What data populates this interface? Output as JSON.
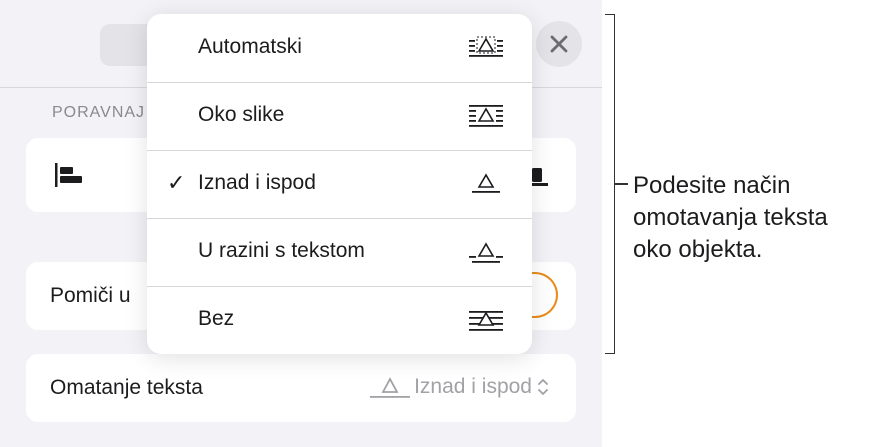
{
  "panel": {
    "section_label": "PORAVNAJ",
    "move_label": "Pomiči u",
    "wrap_label": "Omatanje teksta",
    "wrap_value": "Iznad i ispod"
  },
  "menu": {
    "items": [
      {
        "label": "Automatski",
        "checked": false,
        "icon": "wrap-automatic-icon"
      },
      {
        "label": "Oko slike",
        "checked": false,
        "icon": "wrap-around-icon"
      },
      {
        "label": "Iznad i ispod",
        "checked": true,
        "icon": "wrap-above-below-icon"
      },
      {
        "label": "U razini s tekstom",
        "checked": false,
        "icon": "wrap-inline-icon"
      },
      {
        "label": "Bez",
        "checked": false,
        "icon": "wrap-none-icon"
      }
    ],
    "check_glyph": "✓"
  },
  "callout": {
    "line1": "Podesite način",
    "line2": "omotavanja teksta",
    "line3": "oko objekta."
  },
  "colors": {
    "panel_bg": "#f2f2f7",
    "card_bg": "#ffffff",
    "accent_orange": "#e88b1a",
    "secondary_text": "#8a8a8e"
  }
}
